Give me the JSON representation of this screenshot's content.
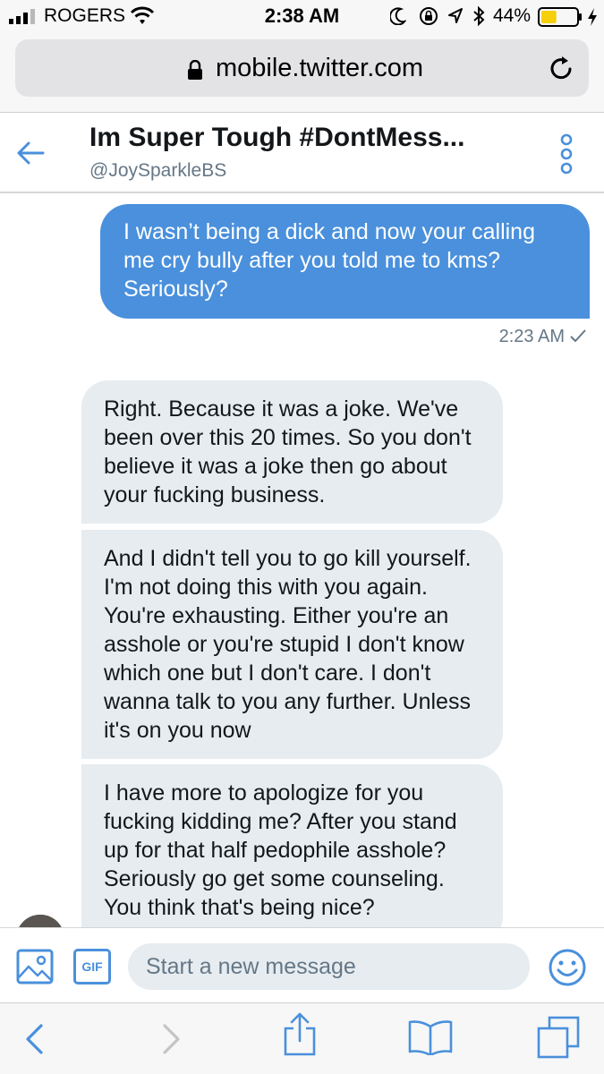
{
  "status_bar": {
    "carrier": "ROGERS",
    "time": "2:38 AM",
    "battery_percent": "44%",
    "battery_level": 0.44,
    "icons": [
      "signal-icon",
      "wifi-icon",
      "moon-icon",
      "orientation-lock-icon",
      "location-icon",
      "bluetooth-icon",
      "battery-icon",
      "charging-icon"
    ]
  },
  "url_bar": {
    "url": "mobile.twitter.com",
    "icons": [
      "lock-icon",
      "reload-icon"
    ]
  },
  "conversation": {
    "name": "Im Super Tough #DontMess...",
    "handle": "@JoySparkleBS",
    "icons": [
      "back-arrow-icon",
      "more-options-icon"
    ]
  },
  "messages": {
    "outgoing": [
      {
        "text": "I wasn’t being a dick and now your calling me cry bully after you told me to kms? Seriously?",
        "time": "2:23 AM"
      }
    ],
    "incoming": [
      {
        "text": "Right. Because it was a joke. We've been over this 20 times. So you don't believe it was a joke then go about your fucking business."
      },
      {
        "text": "And I didn't tell you to go kill yourself. I'm not doing this with you again. You're exhausting. Either you're an asshole or you're stupid I don't know which one but I don't care. I don't wanna talk to you any further. Unless it's on you now"
      },
      {
        "text": "I have more to apologize for you fucking kidding me? After you stand up for that half pedophile asshole? Seriously go get some counseling. You think that's being nice?"
      }
    ]
  },
  "composer": {
    "placeholder": "Start a new message",
    "gif_label": "GIF",
    "icons": [
      "image-icon",
      "emoji-icon"
    ]
  },
  "browser_toolbar": {
    "icons": [
      "back-chevron-icon",
      "forward-chevron-icon",
      "share-icon",
      "bookmarks-icon",
      "tabs-icon"
    ]
  },
  "colors": {
    "accent": "#4a90dc",
    "incoming_bubble": "#e6ecf0",
    "secondary_text": "#657786",
    "battery_fill": "#f5cf0a"
  }
}
